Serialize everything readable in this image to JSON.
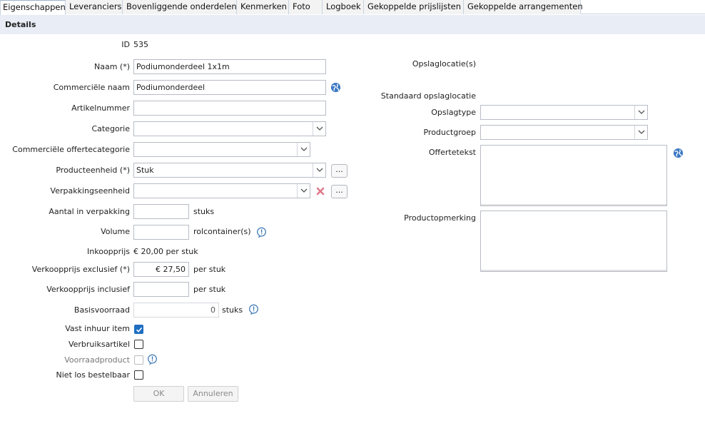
{
  "tabs": [
    "Eigenschappen",
    "Leveranciers",
    "Bovenliggende onderdelen",
    "Kenmerken",
    "Foto",
    "Logboek",
    "Gekoppelde prijslijsten",
    "Gekoppelde arrangementen"
  ],
  "section_title": "Details",
  "fields": {
    "id": {
      "label": "ID",
      "value": "535"
    },
    "naam": {
      "label": "Naam (*)",
      "value": "Podiumonderdeel 1x1m"
    },
    "commerciele_naam": {
      "label": "Commerciële naam",
      "value": "Podiumonderdeel"
    },
    "artikelnummer": {
      "label": "Artikelnummer",
      "value": ""
    },
    "categorie": {
      "label": "Categorie",
      "value": ""
    },
    "commerciele_offertecategorie": {
      "label": "Commerciële offertecategorie",
      "value": ""
    },
    "producteenheid": {
      "label": "Producteenheid (*)",
      "value": "Stuk",
      "more": "..."
    },
    "verpakkingseenheid": {
      "label": "Verpakkingseenheid",
      "value": "",
      "more": "..."
    },
    "aantal_in_verpakking": {
      "label": "Aantal in verpakking",
      "value": "",
      "unit": "stuks"
    },
    "volume": {
      "label": "Volume",
      "value": "",
      "unit": "rolcontainer(s)"
    },
    "inkoopprijs": {
      "label": "Inkoopprijs",
      "value": "€ 20,00 per stuk"
    },
    "verkoopprijs_excl": {
      "label": "Verkoopprijs exclusief (*)",
      "value": "€ 27,50",
      "unit": "per stuk"
    },
    "verkoopprijs_incl": {
      "label": "Verkoopprijs inclusief",
      "value": "",
      "unit": "per stuk"
    },
    "basisvoorraad": {
      "label": "Basisvoorraad",
      "value": "0",
      "unit": "stuks"
    }
  },
  "checkboxes": {
    "vast_inhuur": {
      "label": "Vast inhuur item",
      "checked": true
    },
    "verbruiksartikel": {
      "label": "Verbruiksartikel",
      "checked": false
    },
    "voorraadproduct": {
      "label": "Voorraadproduct",
      "checked": false,
      "disabled": true
    },
    "niet_los_bestelbaar": {
      "label": "Niet los bestelbaar",
      "checked": false
    }
  },
  "buttons": {
    "ok": "OK",
    "cancel": "Annuleren"
  },
  "right": {
    "opslaglocaties": {
      "label": "Opslaglocatie(s)"
    },
    "standaard_opslaglocatie": {
      "label": "Standaard opslaglocatie"
    },
    "opslagtype": {
      "label": "Opslagtype",
      "value": ""
    },
    "productgroep": {
      "label": "Productgroep",
      "value": ""
    },
    "offertetekst": {
      "label": "Offertetekst",
      "value": ""
    },
    "productopmerking": {
      "label": "Productopmerking",
      "value": ""
    }
  },
  "icons": {
    "globe": "globe-icon",
    "delete": "delete-x-icon",
    "info": "info-icon",
    "chevron": "chevron-down-icon"
  },
  "colors": {
    "tab_border": "#c9d3e0",
    "details_bg": "#e8edf6",
    "checkbox_checked": "#1f6ec3",
    "delete_red": "#e07a8a",
    "globe_blue": "#3b78c4"
  }
}
